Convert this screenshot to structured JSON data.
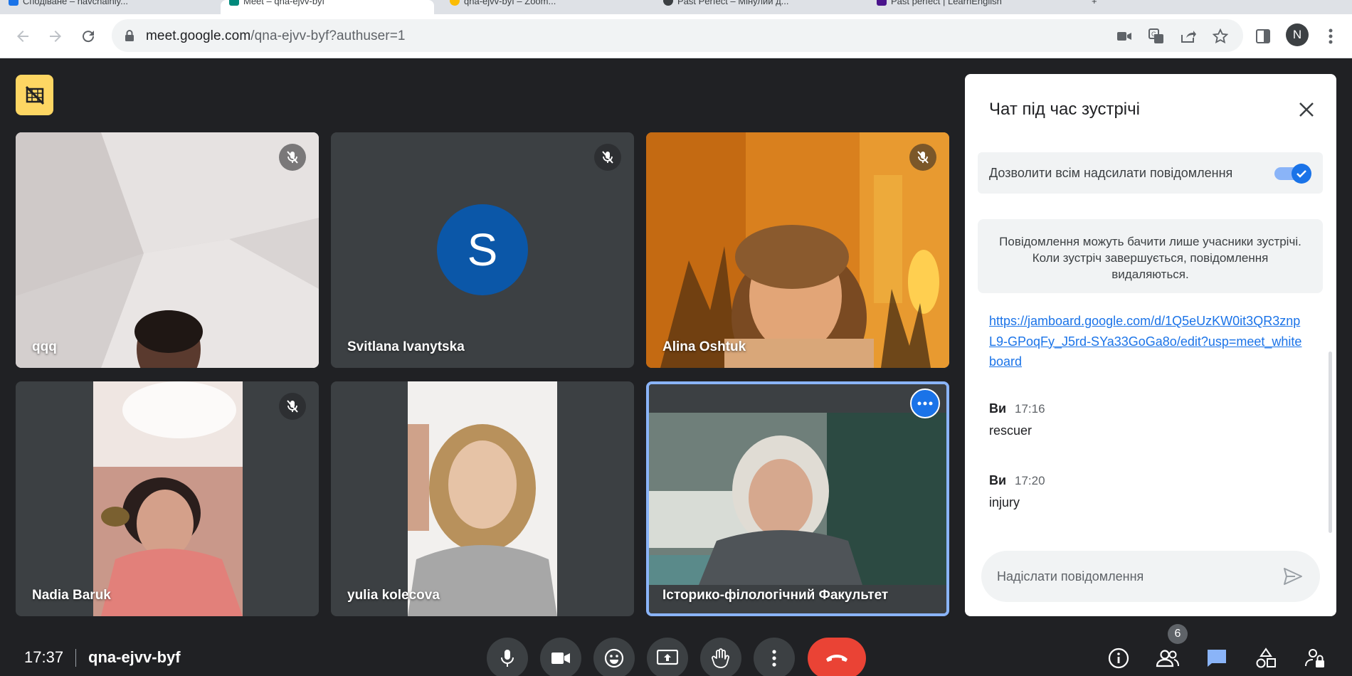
{
  "browser": {
    "tabs": [
      {
        "label": "Сподіване – navchalniy...",
        "favicon_color": "#1a73e8"
      },
      {
        "label": "Meet – qna-ejvv-byf",
        "favicon_color": "#00897b"
      },
      {
        "label": "qna-ejvv-byf – Zoom...",
        "favicon_color": "#fbbc04"
      },
      {
        "label": "Past Perfect – Miнулий д...",
        "favicon_color": "#3c4043"
      },
      {
        "label": "Past perfect | LearnEnglish",
        "favicon_color": "#4a148c"
      }
    ],
    "url_host": "meet.google.com",
    "url_path": "/qna-ejvv-byf?authuser=1",
    "profile_initial": "N"
  },
  "participants": [
    {
      "name": "qqq",
      "muted": true
    },
    {
      "name": "Svitlana Ivanytska",
      "muted": true,
      "avatar_letter": "S"
    },
    {
      "name": "Alina Oshtuk",
      "muted": true
    },
    {
      "name": "Nadia Baruk",
      "muted": true
    },
    {
      "name": "yulia kolecova",
      "muted": false
    },
    {
      "name": "Історико-філологічний Факультет",
      "muted": false,
      "active_speaker": true
    }
  ],
  "chat": {
    "title": "Чат під час зустрічі",
    "permission_label": "Дозволити всім надсилати повідомлення",
    "permission_enabled": true,
    "notice": "Повідомлення можуть бачити лише учасники зустрічі. Коли зустріч завершується, повідомлення видаляються.",
    "link": "https://jamboard.google.com/d/1Q5eUzKW0it3QR3znpL9-GPoqFy_J5rd-SYa33GoGa8o/edit?usp=meet_whiteboard",
    "messages": [
      {
        "sender": "Ви",
        "time": "17:16",
        "text": "rescuer"
      },
      {
        "sender": "Ви",
        "time": "17:20",
        "text": "injury"
      }
    ],
    "compose_placeholder": "Надіслати повідомлення"
  },
  "bottom_bar": {
    "clock": "17:37",
    "meeting_code": "qna-ejvv-byf",
    "participant_count": "6"
  },
  "colors": {
    "background": "#202124",
    "tile": "#3c4043",
    "accent": "#1a73e8",
    "hangup": "#ea4335",
    "badge": "#fdd663"
  }
}
